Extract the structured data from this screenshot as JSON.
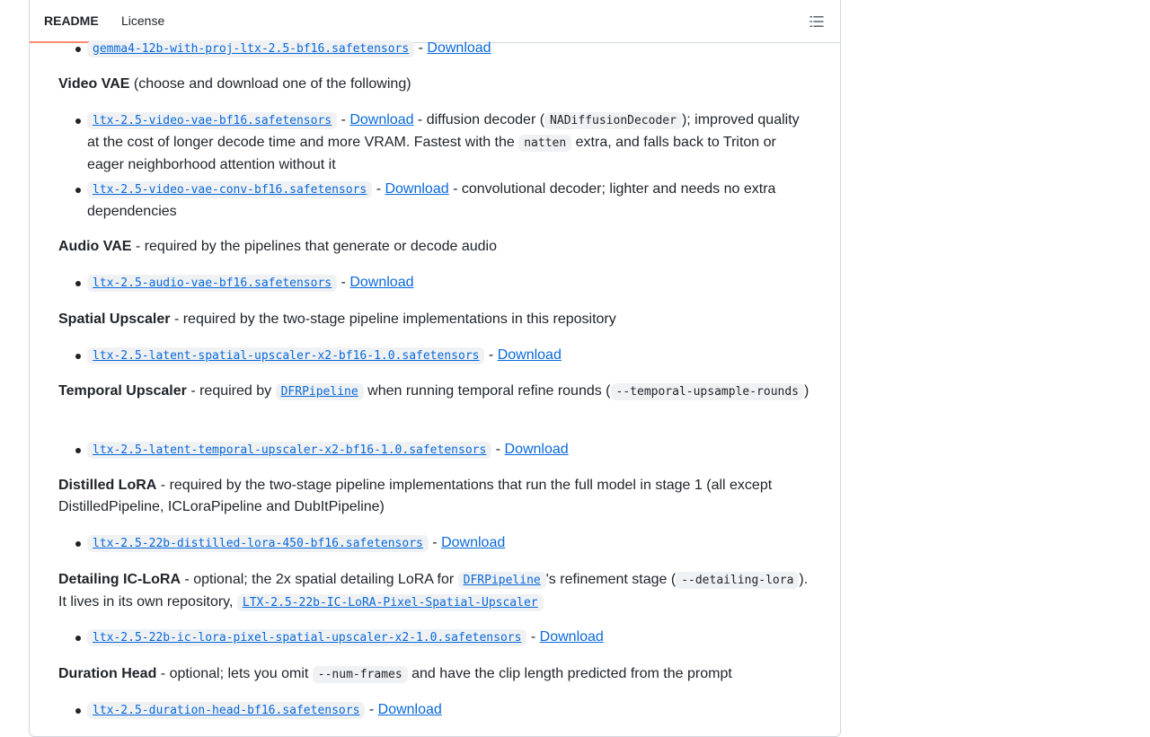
{
  "tabs": {
    "readme": "README",
    "license": "License"
  },
  "items": {
    "gemma": {
      "file": "gemma4-12b-with-proj-ltx-2.5-bf16.safetensors",
      "sep": " - ",
      "link": "Download"
    },
    "video_vae": {
      "title": "Video VAE",
      "desc": " (choose and download one of the following)",
      "opt1": {
        "file": "ltx-2.5-video-vae-bf16.safetensors",
        "sep": " - ",
        "link": "Download",
        "t1": " - diffusion decoder (",
        "code1": "NADiffusionDecoder",
        "t2": "); improved quality at the cost of longer decode time and more VRAM. Fastest with the ",
        "code2": "natten",
        "t3": " extra, and falls back to Triton or eager neighborhood attention without it"
      },
      "opt2": {
        "file": "ltx-2.5-video-vae-conv-bf16.safetensors",
        "sep": " - ",
        "link": "Download",
        "t1": " - convolutional decoder; lighter and needs no extra dependencies"
      }
    },
    "audio_vae": {
      "title": "Audio VAE",
      "desc": " - required by the pipelines that generate or decode audio",
      "file": "ltx-2.5-audio-vae-bf16.safetensors",
      "sep": " - ",
      "link": "Download"
    },
    "spatial": {
      "title": "Spatial Upscaler",
      "desc": " - required by the two-stage pipeline implementations in this repository",
      "file": "ltx-2.5-latent-spatial-upscaler-x2-bf16-1.0.safetensors",
      "sep": " - ",
      "link": "Download"
    },
    "temporal": {
      "title": "Temporal Upscaler",
      "t1": " - required by ",
      "code_link": "DFRPipeline",
      "t2": " when running temporal refine rounds (",
      "code": "--temporal-upsample-rounds",
      "t3": ")",
      "file": "ltx-2.5-latent-temporal-upscaler-x2-bf16-1.0.safetensors",
      "sep": " - ",
      "link": "Download"
    },
    "distilled": {
      "title": "Distilled LoRA",
      "desc": " - required by the two-stage pipeline implementations that run the full model in stage 1 (all except DistilledPipeline, ICLoraPipeline and DubItPipeline)",
      "file": "ltx-2.5-22b-distilled-lora-450-bf16.safetensors",
      "sep": " - ",
      "link": "Download"
    },
    "detailing": {
      "title": "Detailing IC-LoRA",
      "t1": " - optional; the 2x spatial detailing LoRA for ",
      "code_link": "DFRPipeline",
      "t2": "'s refinement stage (",
      "code": "--detailing-lora",
      "t3": "). It lives in its own repository, ",
      "code_link2": "LTX-2.5-22b-IC-LoRA-Pixel-Spatial-Upscaler",
      "file": "ltx-2.5-22b-ic-lora-pixel-spatial-upscaler-x2-1.0.safetensors",
      "sep": " - ",
      "link": "Download"
    },
    "duration": {
      "title": "Duration Head",
      "t1": " - optional; lets you omit ",
      "code": "--num-frames",
      "t2": " and have the clip length predicted from the prompt",
      "file": "ltx-2.5-duration-head-bf16.safetensors",
      "sep": " - ",
      "link": "Download"
    }
  }
}
